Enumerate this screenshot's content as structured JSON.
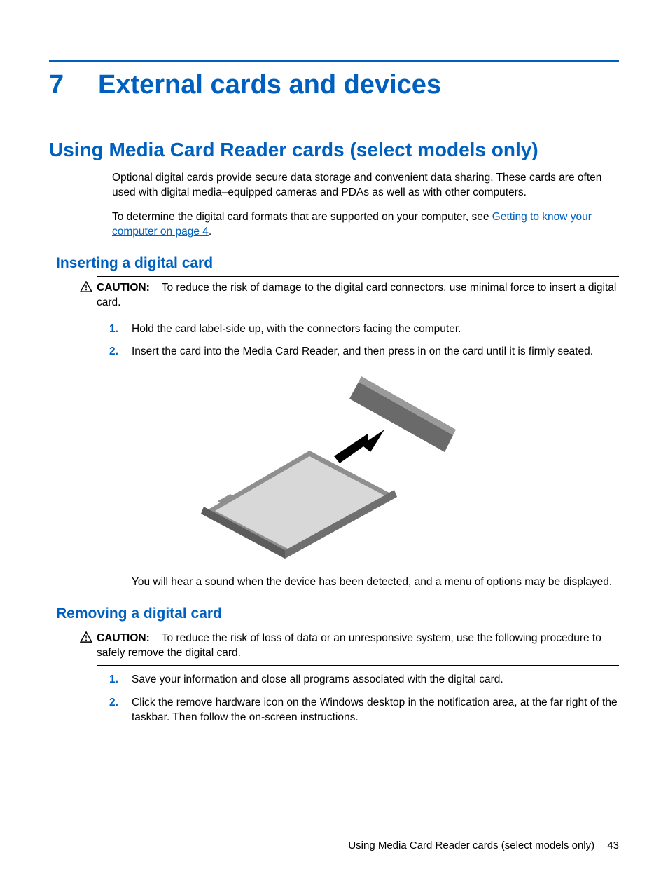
{
  "chapter": {
    "number": "7",
    "title": "External cards and devices"
  },
  "section": {
    "title": "Using Media Card Reader cards (select models only)",
    "intro1": "Optional digital cards provide secure data storage and convenient data sharing. These cards are often used with digital media–equipped cameras and PDAs as well as with other computers.",
    "intro2_pre": "To determine the digital card formats that are supported on your computer, see ",
    "intro2_link": "Getting to know your computer on page 4",
    "intro2_post": "."
  },
  "inserting": {
    "title": "Inserting a digital card",
    "caution_label": "CAUTION:",
    "caution_text": "To reduce the risk of damage to the digital card connectors, use minimal force to insert a digital card.",
    "steps": [
      "Hold the card label-side up, with the connectors facing the computer.",
      "Insert the card into the Media Card Reader, and then press in on the card until it is firmly seated."
    ],
    "note": "You will hear a sound when the device has been detected, and a menu of options may be displayed."
  },
  "removing": {
    "title": "Removing a digital card",
    "caution_label": "CAUTION:",
    "caution_text": "To reduce the risk of loss of data or an unresponsive system, use the following procedure to safely remove the digital card.",
    "steps": [
      "Save your information and close all programs associated with the digital card.",
      "Click the remove hardware icon on the Windows desktop in the notification area, at the far right of the taskbar. Then follow the on-screen instructions."
    ]
  },
  "footer": {
    "text": "Using Media Card Reader cards (select models only)",
    "page": "43"
  }
}
